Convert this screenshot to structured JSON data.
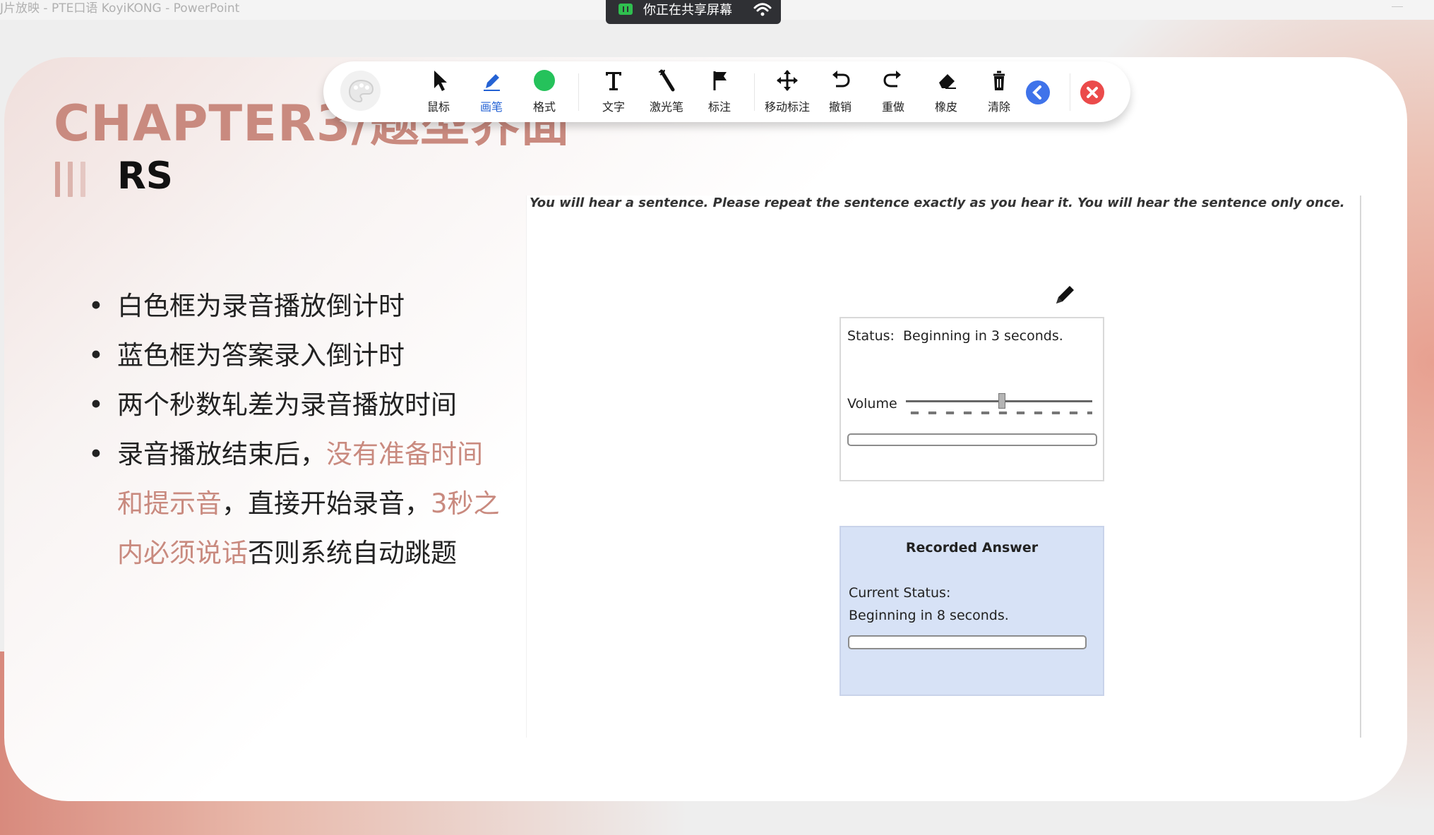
{
  "window": {
    "title": "J片放映 - PTE口语 KoyiKONG - PowerPoint"
  },
  "share_bar": {
    "text": "你正在共享屏幕",
    "accent_color": "#2fbf4f"
  },
  "toolbar": {
    "tools": [
      {
        "label": "鼠标",
        "icon": "cursor-icon"
      },
      {
        "label": "画笔",
        "icon": "pen-icon",
        "active": true
      },
      {
        "label": "格式",
        "icon": "format-color-icon"
      },
      {
        "label": "文字",
        "icon": "text-icon"
      },
      {
        "label": "激光笔",
        "icon": "laser-pointer-icon"
      },
      {
        "label": "标注",
        "icon": "flag-icon"
      },
      {
        "label": "移动标注",
        "icon": "move-icon"
      },
      {
        "label": "撤销",
        "icon": "undo-icon"
      },
      {
        "label": "重做",
        "icon": "redo-icon"
      },
      {
        "label": "橡皮",
        "icon": "eraser-icon"
      },
      {
        "label": "清除",
        "icon": "trash-icon"
      }
    ],
    "format_color": "#25c25b",
    "collapse_color": "#3f73ea",
    "close_color": "#eb4b4b"
  },
  "slide": {
    "chapter_title": "CHAPTER3/题型界面",
    "section": "RS",
    "accent_color": "#c98a7f",
    "bullets": [
      "白色框为录音播放倒计时",
      "蓝色框为答案录入倒计时",
      "两个秒数轧差为录音播放时间"
    ],
    "bullet4": {
      "part1": "录音播放结束后，",
      "highlight1": "没有准备时间和提示音",
      "part2": "，直接开始录音，",
      "highlight2": "3秒之内必须说话",
      "part3": "否则系统自动跳题"
    }
  },
  "exam": {
    "instruction": "You will hear a sentence. Please repeat the sentence exactly as you hear it. You will hear the sentence only once.",
    "status_label": "Status:",
    "status_value": "Beginning in 3 seconds.",
    "volume_label": "Volume",
    "volume_level": 0.5,
    "answer_title": "Recorded Answer",
    "answer_current_label": "Current Status:",
    "answer_current_value": "Beginning in 8 seconds.",
    "answer_box_color": "#d7e2f6"
  }
}
